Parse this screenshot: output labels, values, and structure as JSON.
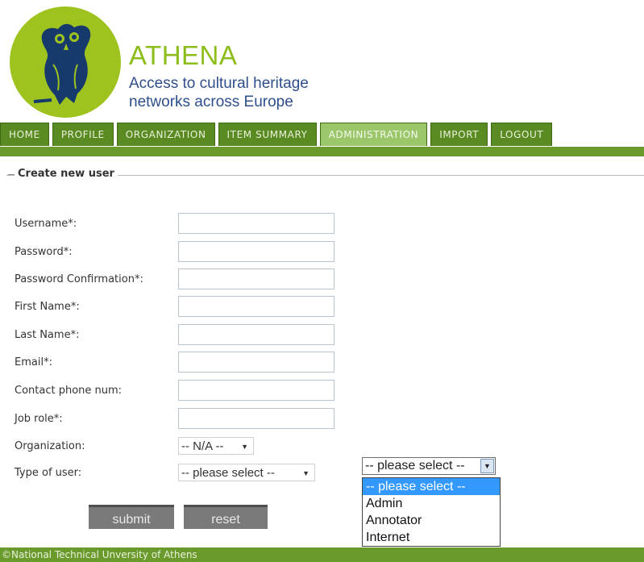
{
  "brand": {
    "title": "ATHENA",
    "tagline": "Access to cultural heritage networks across Europe"
  },
  "nav": {
    "tabs": [
      {
        "label": "HOME",
        "active": false
      },
      {
        "label": "PROFILE",
        "active": false
      },
      {
        "label": "ORGANIZATION",
        "active": false
      },
      {
        "label": "ITEM SUMMARY",
        "active": false
      },
      {
        "label": "ADMINISTRATION",
        "active": true
      },
      {
        "label": "IMPORT",
        "active": false
      },
      {
        "label": "LOGOUT",
        "active": false
      }
    ]
  },
  "form": {
    "legend": "Create new user",
    "fields": {
      "username": {
        "label": "Username*:",
        "value": ""
      },
      "password": {
        "label": "Password*:",
        "value": ""
      },
      "password_confirmation": {
        "label": "Password Confirmation*:",
        "value": ""
      },
      "first_name": {
        "label": "First Name*:",
        "value": ""
      },
      "last_name": {
        "label": "Last Name*:",
        "value": ""
      },
      "email": {
        "label": "Email*:",
        "value": ""
      },
      "contact_phone": {
        "label": "Contact phone num:",
        "value": ""
      },
      "job_role": {
        "label": "Job role*:",
        "value": ""
      }
    },
    "organization": {
      "label": "Organization:",
      "selected": "-- N/A --"
    },
    "type_of_user": {
      "label": "Type of user:",
      "selected": "-- please select --"
    },
    "submit_label": "submit",
    "reset_label": "reset"
  },
  "open_dropdown": {
    "selected": "-- please select --",
    "options": [
      "-- please select --",
      "Admin",
      "Annotator",
      "Internet"
    ],
    "highlighted_index": 0
  },
  "footer": {
    "text": "©National Technical Unversity of Athens"
  },
  "colors": {
    "brand_green": "#8cbd1a",
    "nav_green": "#5a8a22",
    "nav_active": "#9bc66a",
    "tagline_blue": "#2e4f8c",
    "highlight_blue": "#3399ff"
  }
}
